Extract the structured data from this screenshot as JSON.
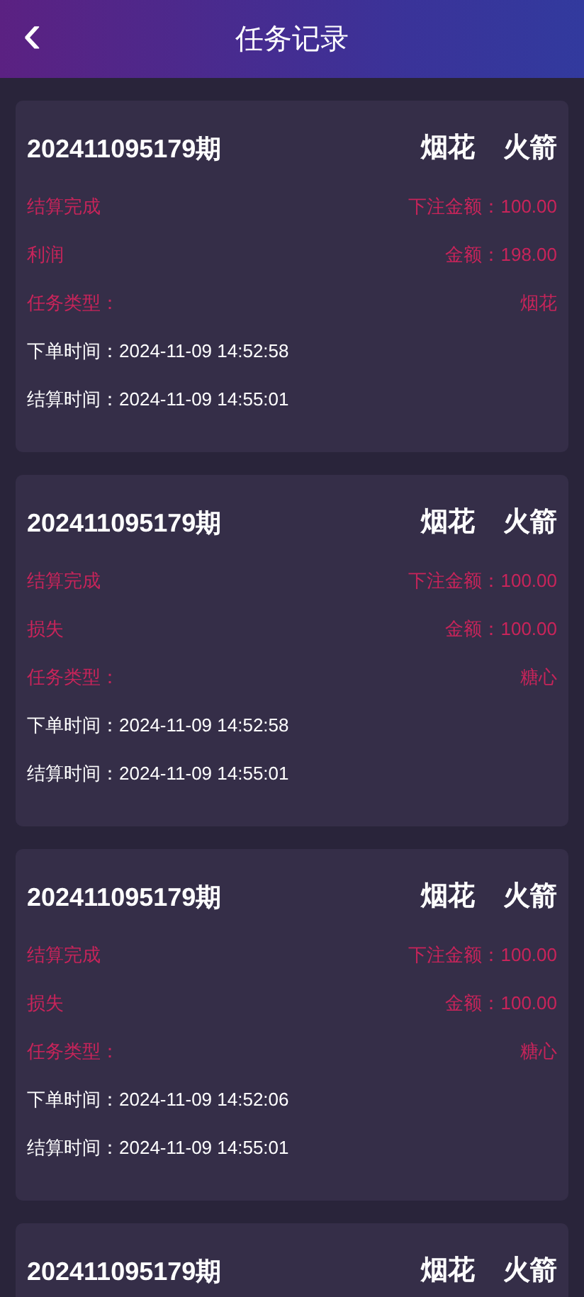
{
  "header": {
    "back": "‹",
    "title": "任务记录"
  },
  "records": [
    {
      "period": "202411095179期",
      "tags": [
        "烟花",
        "火箭"
      ],
      "rows": [
        {
          "left": "结算完成",
          "right": "下注金额：100.00"
        },
        {
          "left": "利润",
          "right": "金额：198.00"
        },
        {
          "left": "任务类型：",
          "right": "烟花"
        }
      ],
      "times": [
        "下单时间：2024-11-09 14:52:58",
        "结算时间：2024-11-09 14:55:01"
      ]
    },
    {
      "period": "202411095179期",
      "tags": [
        "烟花",
        "火箭"
      ],
      "rows": [
        {
          "left": "结算完成",
          "right": "下注金额：100.00"
        },
        {
          "left": "损失",
          "right": "金额：100.00"
        },
        {
          "left": "任务类型：",
          "right": "糖心"
        }
      ],
      "times": [
        "下单时间：2024-11-09 14:52:58",
        "结算时间：2024-11-09 14:55:01"
      ]
    },
    {
      "period": "202411095179期",
      "tags": [
        "烟花",
        "火箭"
      ],
      "rows": [
        {
          "left": "结算完成",
          "right": "下注金额：100.00"
        },
        {
          "left": "损失",
          "right": "金额：100.00"
        },
        {
          "left": "任务类型：",
          "right": "糖心"
        }
      ],
      "times": [
        "下单时间：2024-11-09 14:52:06",
        "结算时间：2024-11-09 14:55:01"
      ]
    },
    {
      "period": "202411095179期",
      "tags": [
        "烟花",
        "火箭"
      ]
    }
  ]
}
